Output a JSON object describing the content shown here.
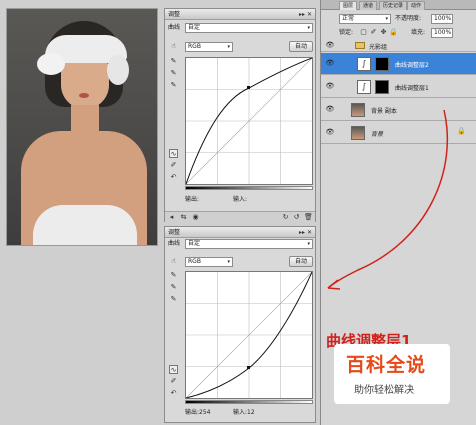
{
  "adjust_panel_top": {
    "title": "调整",
    "close": "▸▸ ✕",
    "menu_label": "曲线",
    "preset_value": "自定",
    "channel_value": "RGB",
    "auto_label": "自动",
    "output_label": "输出:",
    "input_label": "输入:"
  },
  "adjust_panel_bottom": {
    "title": "调整",
    "close": "▸▸ ✕",
    "menu_label": "曲线",
    "preset_value": "自定",
    "channel_value": "RGB",
    "auto_label": "自动",
    "output_label": "输出:",
    "output_value": "254",
    "input_label": "输入:",
    "input_value": "12"
  },
  "layers": {
    "tabs": [
      "图层",
      "通道",
      "历史记录",
      "动作"
    ],
    "blend_mode": "正常",
    "opacity_label": "不透明度:",
    "opacity_value": "100%",
    "lock_label": "锁定:",
    "fill_label": "填充:",
    "fill_value": "100%",
    "items": [
      {
        "name": "光影组"
      },
      {
        "name": "曲线调整层2"
      },
      {
        "name": "曲线调整层1"
      },
      {
        "name": "背景 副本"
      },
      {
        "name": "背景"
      }
    ]
  },
  "annotation": {
    "text": "曲线调整层1",
    "color": "#d0221a"
  },
  "watermark": {
    "title": "百科全说",
    "subtitle": "助你轻松解决",
    "title_color": "#e64a19"
  }
}
